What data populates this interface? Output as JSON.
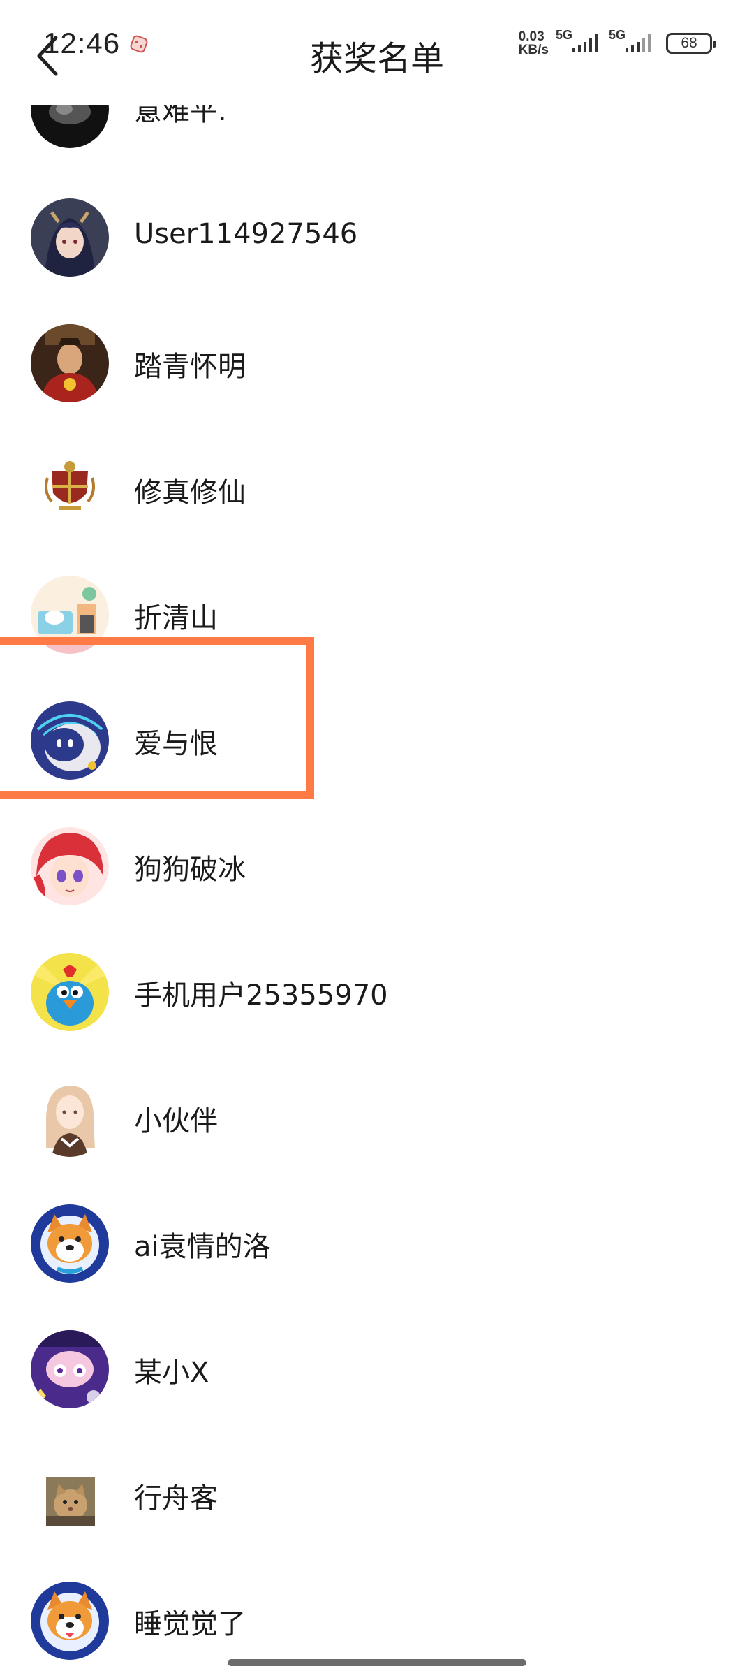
{
  "status_bar": {
    "time": "12:46",
    "net_speed_value": "0.03",
    "net_speed_unit": "KB/s",
    "signal_1": "5G",
    "signal_2": "5G",
    "battery": "68"
  },
  "header": {
    "title": "获奖名单"
  },
  "winners": [
    {
      "name": "意难平.",
      "avatar": "dark-avatar"
    },
    {
      "name": "User114927546",
      "avatar": "anime-girl-avatar"
    },
    {
      "name": "踏青怀明",
      "avatar": "emperor-avatar"
    },
    {
      "name": "修真修仙",
      "avatar": "crest-avatar"
    },
    {
      "name": "折清山",
      "avatar": "cartoon-room-avatar"
    },
    {
      "name": "爱与恨",
      "avatar": "robot-avatar"
    },
    {
      "name": "狗狗破冰",
      "avatar": "red-hair-girl-avatar"
    },
    {
      "name": "手机用户25355970",
      "avatar": "blue-bird-avatar"
    },
    {
      "name": "小伙伴",
      "avatar": "maid-girl-avatar"
    },
    {
      "name": "ai袁情的洛",
      "avatar": "shiba-dog-avatar"
    },
    {
      "name": "某小X",
      "avatar": "purple-character-avatar"
    },
    {
      "name": "行舟客",
      "avatar": "cat-meme-avatar"
    },
    {
      "name": "睡觉觉了",
      "avatar": "shiba-dog-avatar"
    }
  ],
  "colors": {
    "highlight": "#ff7a45",
    "text": "#1a1a1a",
    "background": "#ffffff"
  }
}
